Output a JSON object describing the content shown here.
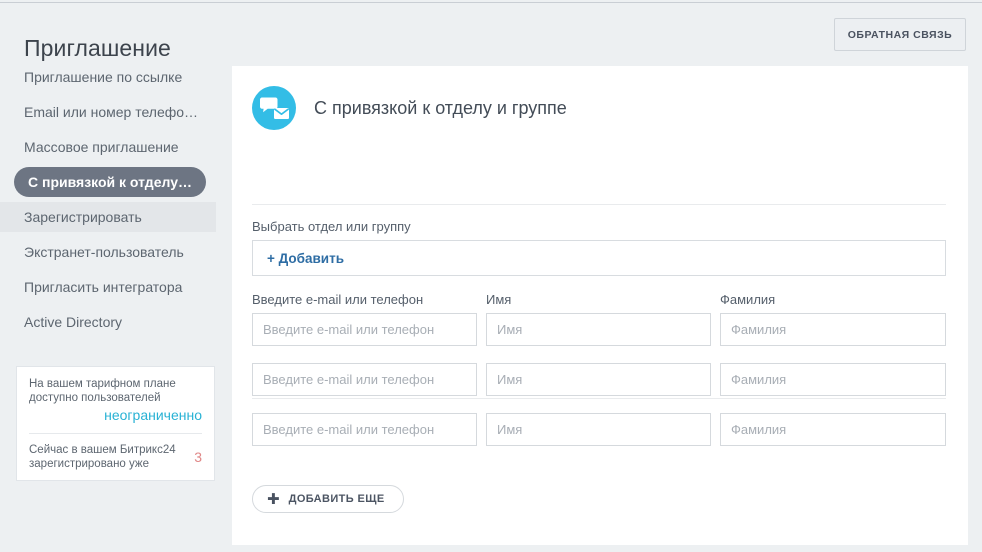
{
  "header": {
    "title": "Приглашение",
    "feedback_label": "ОБРАТНАЯ СВЯЗЬ"
  },
  "sidebar": {
    "items": [
      {
        "label": "Приглашение по ссылке",
        "state": "normal"
      },
      {
        "label": "Email или номер телефо…",
        "state": "normal"
      },
      {
        "label": "Массовое приглашение",
        "state": "normal"
      },
      {
        "label": "С привязкой к отделу и …",
        "state": "active"
      },
      {
        "label": "Зарегистрировать",
        "state": "hovered"
      },
      {
        "label": "Экстранет-пользователь",
        "state": "normal"
      },
      {
        "label": "Пригласить интегратора",
        "state": "normal"
      },
      {
        "label": "Active Directory",
        "state": "normal"
      }
    ],
    "quota": {
      "plan_text": "На вашем тарифном плане доступно пользователей",
      "plan_value": "неограниченно",
      "registered_text": "Сейчас в вашем Битрикс24 зарегистрировано уже",
      "registered_count": "3"
    }
  },
  "main": {
    "icon_name": "chat-mail-icon",
    "title": "С привязкой к отделу и группе",
    "department_label": "Выбрать отдел или группу",
    "add_department_label": "+ Добавить",
    "columns": [
      {
        "label": "Введите e-mail или телефон",
        "placeholder": "Введите e-mail или телефон"
      },
      {
        "label": "Имя",
        "placeholder": "Имя"
      },
      {
        "label": "Фамилия",
        "placeholder": "Фамилия"
      }
    ],
    "rows": [
      {
        "email": "",
        "first_name": "",
        "last_name": ""
      },
      {
        "email": "",
        "first_name": "",
        "last_name": ""
      },
      {
        "email": "",
        "first_name": "",
        "last_name": ""
      }
    ],
    "add_more_plus": "✚",
    "add_more_label": "ДОБАВИТЬ ЕЩЕ"
  },
  "colors": {
    "page_bg": "#edf0f2",
    "accent_cyan": "#33bde6",
    "link_blue": "#2e6da4",
    "active_pill": "#6d7583",
    "quota_value": "#29b2d4",
    "count_red": "#e08888"
  }
}
